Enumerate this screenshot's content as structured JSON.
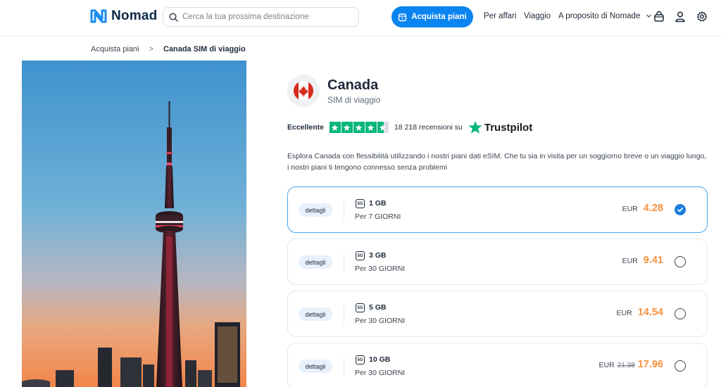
{
  "header": {
    "brand": "Nomad",
    "search_placeholder": "Cerca la tua prossima destinazione",
    "buy_label": "Acquista piani",
    "nav": [
      "Per affari",
      "Viaggio",
      "A proposito di Nomade"
    ]
  },
  "breadcrumb": {
    "parent": "Acquista piani",
    "separator": ">",
    "current": "Canada SIM di viaggio"
  },
  "product": {
    "country": "Canada",
    "subtitle": "SIM di viaggio",
    "rating_label": "Eccellente",
    "stars": 4.5,
    "reviews": "18 218 recensioni su",
    "trustpilot": "Trustpilot",
    "description": "Esplora Canada con flessibilità utilizzando i nostri piani dati eSIM. Che tu sia in visita per un soggiorno breve o un viaggio lungo, i nostri piani ti tengono connesso senza problemi"
  },
  "plans": [
    {
      "details": "dettagli",
      "network": "5G",
      "data": "1 GB",
      "duration": "Per 7 GIORNI",
      "currency": "EUR",
      "old_price": "",
      "price": "4.28",
      "selected": true
    },
    {
      "details": "dettagli",
      "network": "5G",
      "data": "3 GB",
      "duration": "Per 30 GIORNI",
      "currency": "EUR",
      "old_price": "",
      "price": "9.41",
      "selected": false
    },
    {
      "details": "dettagli",
      "network": "5G",
      "data": "5 GB",
      "duration": "Per 30 GIORNI",
      "currency": "EUR",
      "old_price": "",
      "price": "14.54",
      "selected": false
    },
    {
      "details": "dettagli",
      "network": "5G",
      "data": "10 GB",
      "duration": "Per 30 GIORNI",
      "currency": "EUR",
      "old_price": "21.38",
      "price": "17.96",
      "selected": false
    }
  ],
  "colors": {
    "accent": "#0a84f0",
    "price": "#f5923e",
    "trustpilot": "#00b67a"
  },
  "icons": [
    "nomad-logo-icon",
    "search-icon",
    "shop-icon",
    "chevron-down-icon",
    "bag-icon",
    "user-icon",
    "gear-icon",
    "canada-flag-icon",
    "trustpilot-star-icon",
    "check-icon"
  ]
}
